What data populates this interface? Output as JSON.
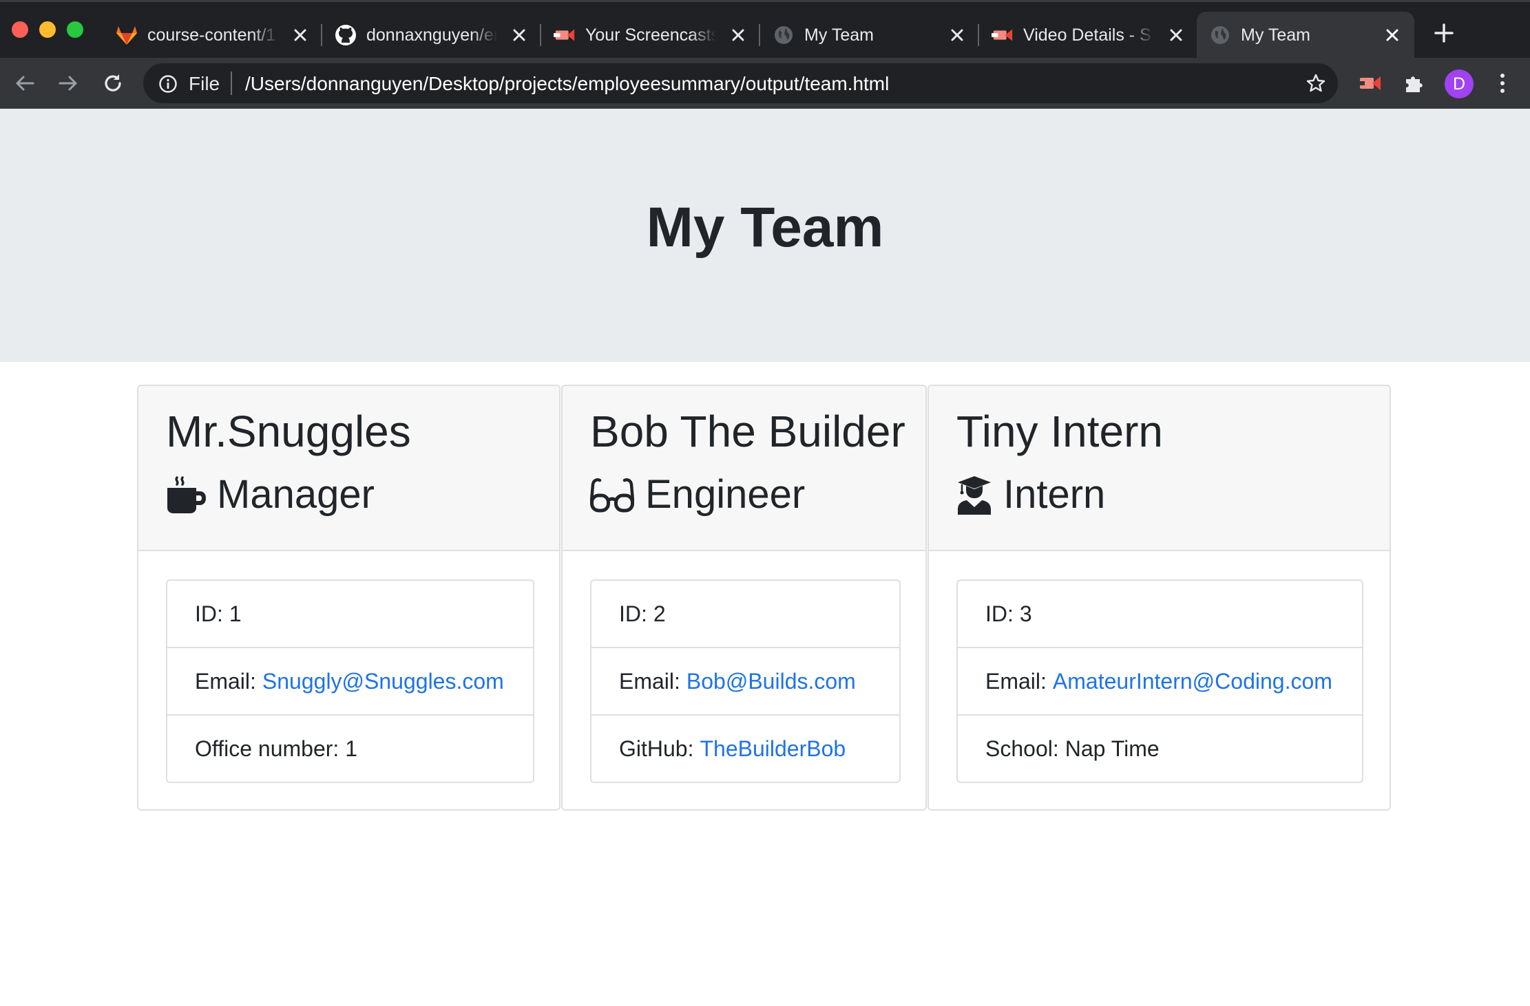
{
  "browser": {
    "tabs": [
      {
        "title": "course-content/1",
        "icon": "gitlab-icon",
        "active": false
      },
      {
        "title": "donnaxnguyen/em",
        "icon": "github-icon",
        "active": false
      },
      {
        "title": "Your Screencasts",
        "icon": "screencastify-icon",
        "active": false
      },
      {
        "title": "My Team",
        "icon": "globe-icon",
        "active": false
      },
      {
        "title": "Video Details - S",
        "icon": "screencastify-icon",
        "active": false
      },
      {
        "title": "My Team",
        "icon": "globe-icon",
        "active": true
      }
    ],
    "address": {
      "scheme_label": "File",
      "url": "/Users/donnanguyen/Desktop/projects/employeesummary/output/team.html"
    },
    "profile_initial": "D",
    "colors": {
      "tab_bar": "#202124",
      "toolbar": "#35363a",
      "avatar": "#a142f4"
    }
  },
  "page": {
    "title": "My Team",
    "colors": {
      "jumbotron": "#e9ecef",
      "link": "#1f73e8",
      "text": "#212529"
    }
  },
  "team": [
    {
      "name": "Mr.Snuggles",
      "role": "Manager",
      "role_icon": "coffee-mug-icon",
      "id_label": "ID:",
      "id": "1",
      "email_label": "Email:",
      "email": "Snuggly@Snuggles.com",
      "extra_label": "Office number:",
      "extra": "1",
      "extra_is_link": false
    },
    {
      "name": "Bob The Builder",
      "role": "Engineer",
      "role_icon": "glasses-icon",
      "id_label": "ID:",
      "id": "2",
      "email_label": "Email:",
      "email": "Bob@Builds.com",
      "extra_label": "GitHub:",
      "extra": "TheBuilderBob",
      "extra_is_link": true
    },
    {
      "name": "Tiny Intern",
      "role": "Intern",
      "role_icon": "graduate-icon",
      "id_label": "ID:",
      "id": "3",
      "email_label": "Email:",
      "email": "AmateurIntern@Coding.com",
      "extra_label": "School:",
      "extra": "Nap Time",
      "extra_is_link": false
    }
  ]
}
